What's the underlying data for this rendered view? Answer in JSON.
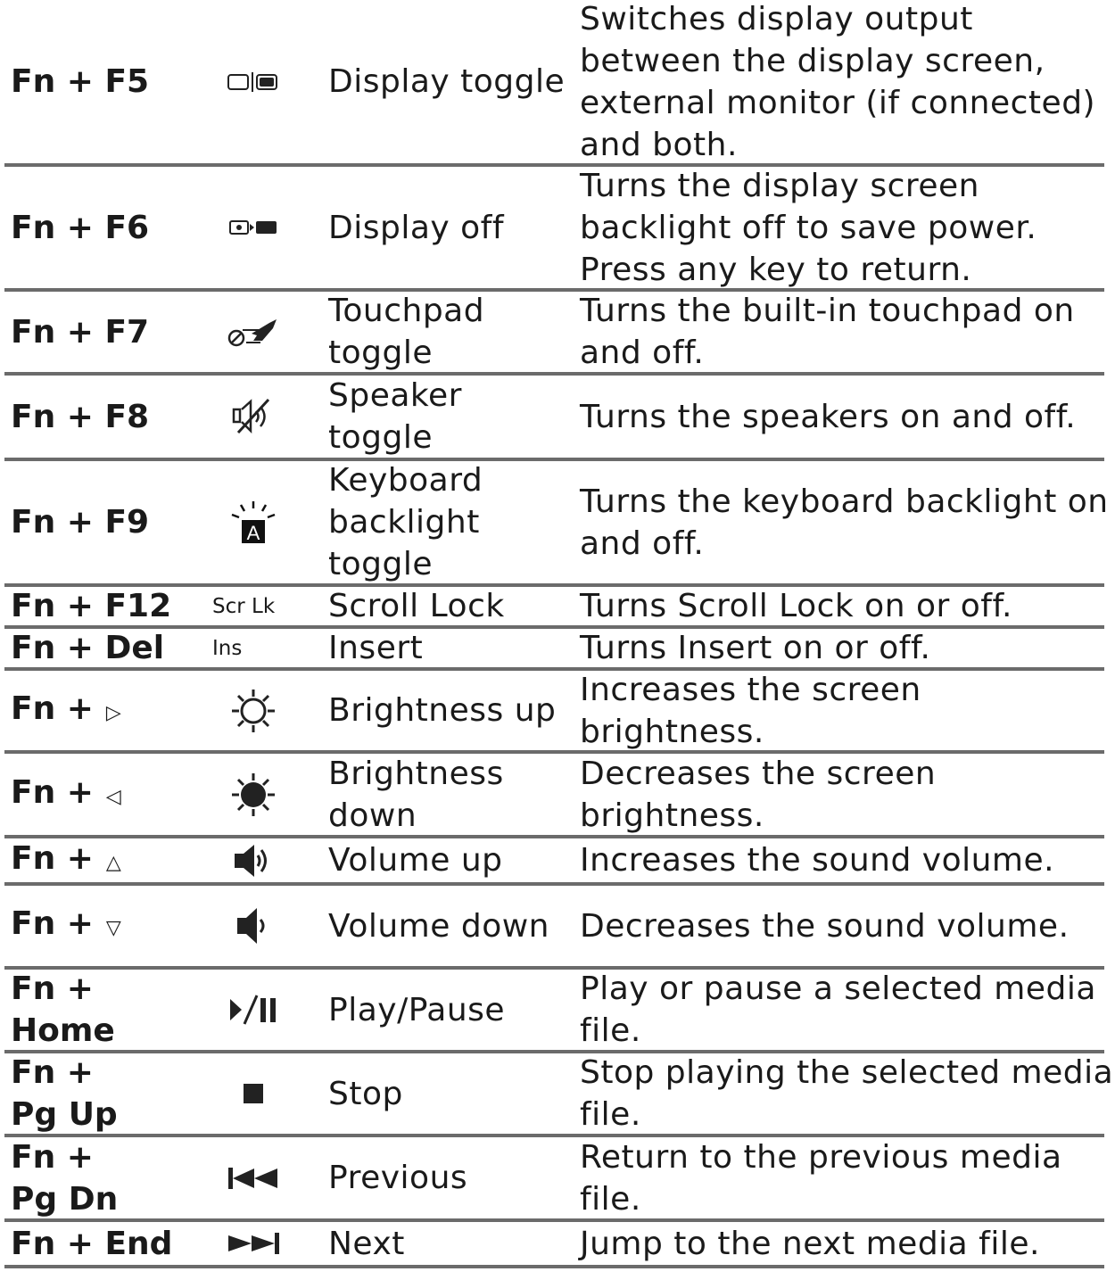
{
  "rows": [
    {
      "key": "Fn + F5",
      "icon": "display-toggle-icon",
      "function": "Display toggle",
      "description": "Switches display output between the display screen, external monitor (if connected) and both."
    },
    {
      "key": "Fn + F6",
      "icon": "display-off-icon",
      "function": "Display off",
      "description": "Turns the display screen backlight off to save power. Press any key to return."
    },
    {
      "key": "Fn + F7",
      "icon": "touchpad-toggle-icon",
      "function": "Touchpad toggle",
      "description": "Turns the built-in touchpad on and off."
    },
    {
      "key": "Fn + F8",
      "icon": "speaker-mute-icon",
      "function": "Speaker toggle",
      "description": "Turns the speakers on and off."
    },
    {
      "key": "Fn + F9",
      "icon": "keyboard-backlight-icon",
      "function": "Keyboard backlight toggle",
      "description": "Turns the keyboard backlight on and off."
    },
    {
      "key": "Fn + F12",
      "icon_text": "Scr Lk",
      "function": "Scroll Lock",
      "description": "Turns Scroll Lock on or off."
    },
    {
      "key": "Fn + Del",
      "icon_text": "Ins",
      "function": "Insert",
      "description": "Turns Insert on or off."
    },
    {
      "key": "Fn +",
      "key_arrow": "▷",
      "icon": "brightness-up-icon",
      "function": "Brightness up",
      "description": "Increases the screen brightness."
    },
    {
      "key": "Fn +",
      "key_arrow": "◁",
      "icon": "brightness-down-icon",
      "function": "Brightness down",
      "description": "Decreases the screen brightness."
    },
    {
      "key": "Fn +",
      "key_arrow": "△",
      "icon": "volume-up-icon",
      "function": "Volume up",
      "description": "Increases the sound volume."
    },
    {
      "key": "Fn +",
      "key_arrow": "▽",
      "icon": "volume-down-icon",
      "function": "Volume down",
      "description": "Decreases the sound volume."
    },
    {
      "key": "Fn + Home",
      "icon": "play-pause-icon",
      "function": "Play/Pause",
      "description": "Play or pause a selected media file."
    },
    {
      "key": "Fn + Pg Up",
      "icon": "stop-icon",
      "function": "Stop",
      "description": "Stop playing the selected media file."
    },
    {
      "key": "Fn + Pg Dn",
      "icon": "previous-icon",
      "function": "Previous",
      "description": "Return to the previous media file."
    },
    {
      "key": "Fn + End",
      "icon": "next-icon",
      "function": "Next",
      "description": "Jump to the next media file."
    }
  ],
  "colors": {
    "separator": "#6b6b6b",
    "text": "#1a1a1a"
  }
}
